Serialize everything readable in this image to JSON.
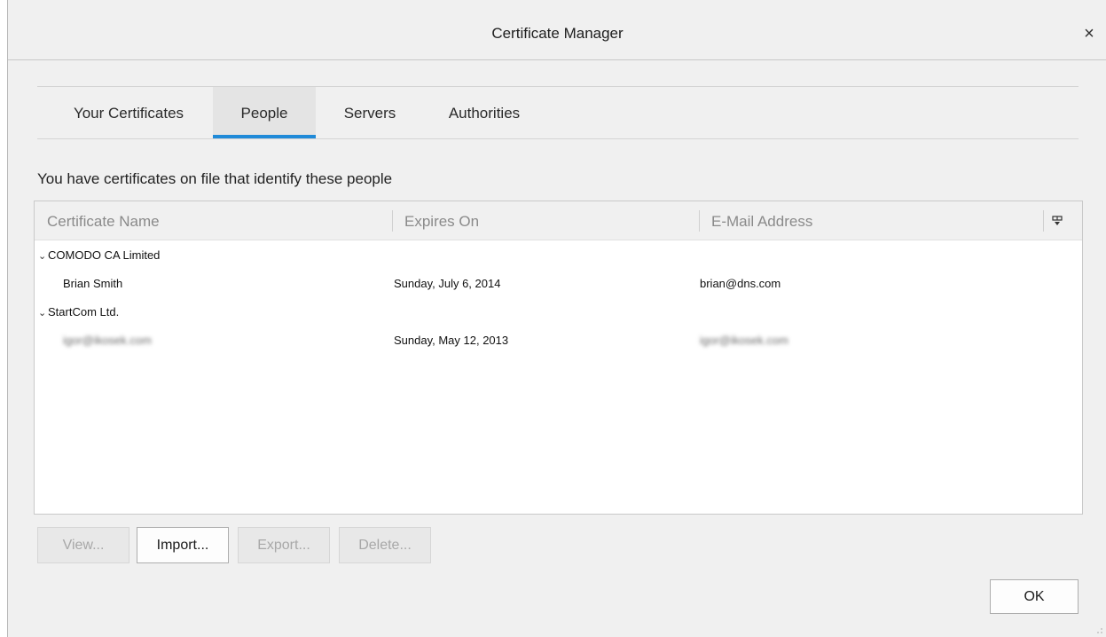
{
  "window": {
    "title": "Certificate Manager",
    "close_glyph": "×"
  },
  "tabs": [
    {
      "label": "Your Certificates",
      "active": false
    },
    {
      "label": "People",
      "active": true
    },
    {
      "label": "Servers",
      "active": false
    },
    {
      "label": "Authorities",
      "active": false
    }
  ],
  "intro_text": "You have certificates on file that identify these people",
  "table": {
    "columns": [
      "Certificate Name",
      "Expires On",
      "E-Mail Address"
    ],
    "column_picker_icon": "column-picker-icon",
    "groups": [
      {
        "name": "COMODO CA Limited",
        "expanded": true,
        "rows": [
          {
            "name": "Brian Smith",
            "expires": "Sunday, July 6, 2014",
            "email": "brian@dns.com",
            "obscured": false
          }
        ]
      },
      {
        "name": "StartCom Ltd.",
        "expanded": true,
        "rows": [
          {
            "name": "igor@ikosek.com",
            "expires": "Sunday, May 12, 2013",
            "email": "igor@ikosek.com",
            "obscured": true
          }
        ]
      }
    ]
  },
  "buttons": {
    "view": {
      "label": "View...",
      "enabled": false
    },
    "import": {
      "label": "Import...",
      "enabled": true
    },
    "export": {
      "label": "Export...",
      "enabled": false
    },
    "delete": {
      "label": "Delete...",
      "enabled": false
    },
    "ok": {
      "label": "OK",
      "enabled": true
    }
  },
  "colors": {
    "active_tab_underline": "#1f8ad8",
    "dialog_background": "#f0f0f0"
  }
}
